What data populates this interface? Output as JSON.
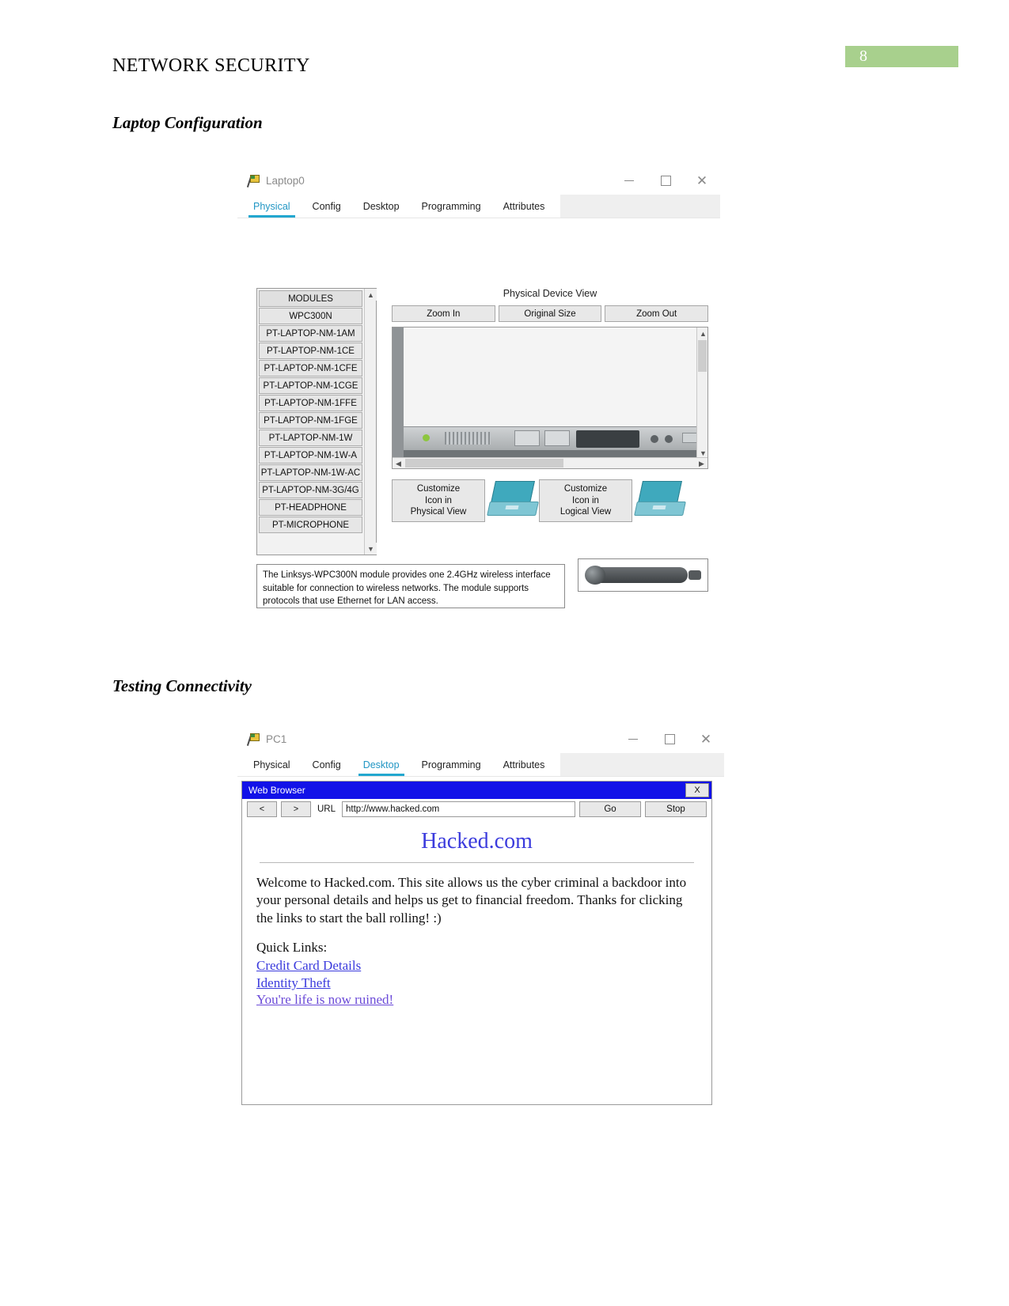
{
  "document": {
    "header_title": "NETWORK SECURITY",
    "page_number": "8",
    "section_laptop": "Laptop Configuration",
    "section_testing": "Testing Connectivity"
  },
  "laptop_window": {
    "title": "Laptop0",
    "minimize_label": "Minimize",
    "maximize_label": "Maximize",
    "close_label": "Close",
    "tabs": [
      {
        "label": "Physical",
        "active": true
      },
      {
        "label": "Config",
        "active": false
      },
      {
        "label": "Desktop",
        "active": false
      },
      {
        "label": "Programming",
        "active": false
      },
      {
        "label": "Attributes",
        "active": false
      }
    ],
    "modules": [
      "MODULES",
      "WPC300N",
      "PT-LAPTOP-NM-1AM",
      "PT-LAPTOP-NM-1CE",
      "PT-LAPTOP-NM-1CFE",
      "PT-LAPTOP-NM-1CGE",
      "PT-LAPTOP-NM-1FFE",
      "PT-LAPTOP-NM-1FGE",
      "PT-LAPTOP-NM-1W",
      "PT-LAPTOP-NM-1W-A",
      "PT-LAPTOP-NM-1W-AC",
      "PT-LAPTOP-NM-3G/4G",
      "PT-HEADPHONE",
      "PT-MICROPHONE"
    ],
    "physical_device_view_title": "Physical Device View",
    "zoom_buttons": [
      "Zoom In",
      "Original Size",
      "Zoom Out"
    ],
    "customize_physical_line1": "Customize",
    "customize_physical_line2": "Icon in",
    "customize_physical_line3": "Physical View",
    "customize_logical_line1": "Customize",
    "customize_logical_line2": "Icon in",
    "customize_logical_line3": "Logical View",
    "description": "The Linksys-WPC300N module provides one 2.4GHz wireless interface suitable for connection to wireless networks. The module supports protocols that use Ethernet for LAN access."
  },
  "pc_window": {
    "title": "PC1",
    "tabs": [
      {
        "label": "Physical",
        "active": false
      },
      {
        "label": "Config",
        "active": false
      },
      {
        "label": "Desktop",
        "active": true
      },
      {
        "label": "Programming",
        "active": false
      },
      {
        "label": "Attributes",
        "active": false
      }
    ],
    "browser": {
      "title": "Web Browser",
      "close_label": "X",
      "back_label": "<",
      "forward_label": ">",
      "url_label": "URL",
      "url_value": "http://www.hacked.com",
      "go_label": "Go",
      "stop_label": "Stop",
      "page_heading": "Hacked.com",
      "page_paragraph": "Welcome to Hacked.com. This site allows us the cyber criminal a backdoor into your personal details and helps us get to financial freedom. Thanks for clicking the links to start the ball rolling! :)",
      "quick_links_label": "Quick Links:",
      "links": [
        "Credit Card Details",
        "Identity Theft",
        "You're life is now ruined!"
      ]
    }
  },
  "colors": {
    "page_badge_bg": "#a8d08d",
    "tab_active": "#22a7cf",
    "browser_titlebar": "#1212e8",
    "link": "#3b3bdd"
  }
}
